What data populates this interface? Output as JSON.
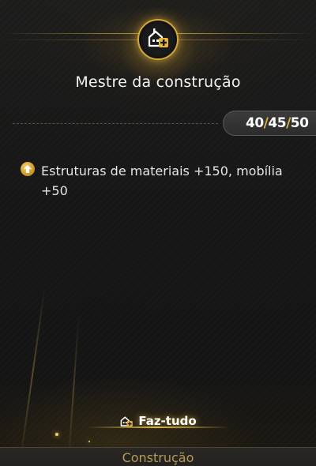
{
  "header": {
    "icon": "building-plus-icon",
    "title": "Mestre da construção"
  },
  "level": {
    "current": "40",
    "separator": "/",
    "mid": "45",
    "max": "50"
  },
  "bonuses": [
    {
      "icon": "upgrade-arrow-icon",
      "text": "Estruturas de materiais +150, mobília +50"
    }
  ],
  "footer": {
    "handyman_icon": "building-plus-icon",
    "handyman_label": "Faz-tudo",
    "tab_label": "Construção"
  },
  "colors": {
    "accent_gold": "#d3a63b",
    "background": "#1b1b1b",
    "tab_text": "#b89a56"
  }
}
